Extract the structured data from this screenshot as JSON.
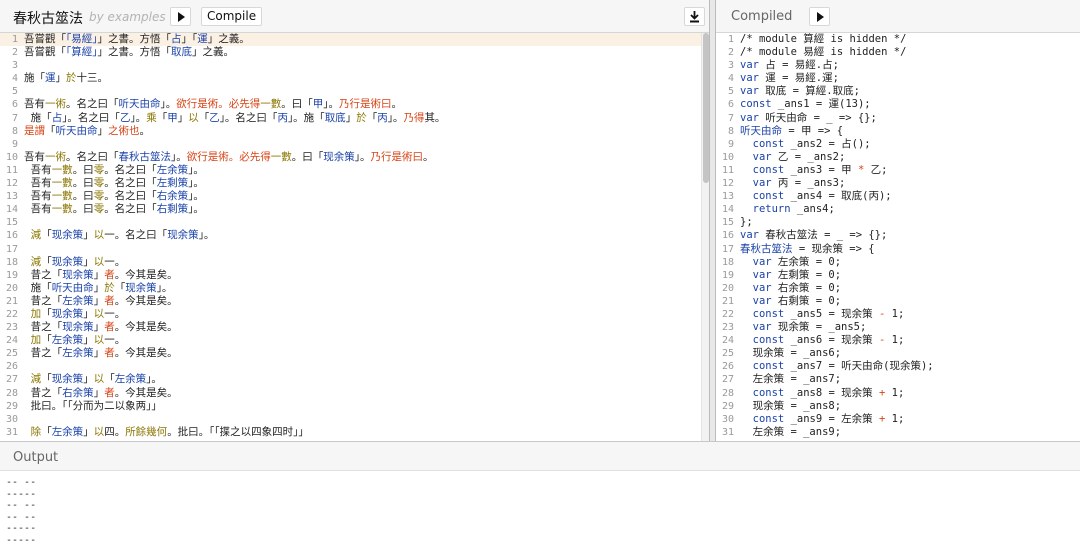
{
  "app": {
    "title": "春秋古筮法",
    "subtitle": "by examples",
    "compile_label": "Compile"
  },
  "right": {
    "title": "Compiled"
  },
  "output": {
    "title": "Output",
    "lines": [
      "-- --",
      "-----",
      "-- --",
      "-- --",
      "-----",
      "-----"
    ]
  },
  "source_lines": [
    [
      [
        "吾嘗觀「",
        "c-dark"
      ],
      [
        "「易經」",
        "c-blue"
      ],
      [
        "」之書。方悟「",
        "c-dark"
      ],
      [
        "占",
        "c-blue"
      ],
      [
        "」「",
        "c-dark"
      ],
      [
        "運",
        "c-blue"
      ],
      [
        "」之義。",
        "c-dark"
      ]
    ],
    [
      [
        "吾嘗觀「",
        "c-dark"
      ],
      [
        "「算經」",
        "c-blue"
      ],
      [
        "」之書。方悟「",
        "c-dark"
      ],
      [
        "取底",
        "c-blue"
      ],
      [
        "」之義。",
        "c-dark"
      ]
    ],
    [],
    [
      [
        "施「",
        "c-dark"
      ],
      [
        "運",
        "c-blue"
      ],
      [
        "」",
        "c-dark"
      ],
      [
        "於",
        "c-olive"
      ],
      [
        "十三。",
        "c-dark"
      ]
    ],
    [],
    [
      [
        "吾有",
        "c-dark"
      ],
      [
        "一術",
        "c-olive"
      ],
      [
        "。名之曰「",
        "c-dark"
      ],
      [
        "听天由命",
        "c-blue"
      ],
      [
        "」。",
        "c-dark"
      ],
      [
        "欲行是術。必先得",
        "c-orange"
      ],
      [
        "一數",
        "c-olive"
      ],
      [
        "。曰「",
        "c-dark"
      ],
      [
        "甲",
        "c-blue"
      ],
      [
        "」。",
        "c-dark"
      ],
      [
        "乃行是術曰",
        "c-orange"
      ],
      [
        "。",
        "c-dark"
      ]
    ],
    [
      [
        "  施「",
        "c-dark"
      ],
      [
        "占",
        "c-blue"
      ],
      [
        "」。名之曰「",
        "c-dark"
      ],
      [
        "乙",
        "c-blue"
      ],
      [
        "」。",
        "c-dark"
      ],
      [
        "乘",
        "c-olive"
      ],
      [
        "「",
        "c-dark"
      ],
      [
        "甲",
        "c-blue"
      ],
      [
        "」",
        "c-dark"
      ],
      [
        "以",
        "c-olive"
      ],
      [
        "「",
        "c-dark"
      ],
      [
        "乙",
        "c-blue"
      ],
      [
        "」。名之曰「",
        "c-dark"
      ],
      [
        "丙",
        "c-blue"
      ],
      [
        "」。施「",
        "c-dark"
      ],
      [
        "取底",
        "c-blue"
      ],
      [
        "」",
        "c-dark"
      ],
      [
        "於",
        "c-olive"
      ],
      [
        "「",
        "c-dark"
      ],
      [
        "丙",
        "c-blue"
      ],
      [
        "」。",
        "c-dark"
      ],
      [
        "乃得",
        "c-orange"
      ],
      [
        "其。",
        "c-dark"
      ]
    ],
    [
      [
        "是謂",
        "c-orange"
      ],
      [
        "「",
        "c-dark"
      ],
      [
        "听天由命",
        "c-blue"
      ],
      [
        "」",
        "c-dark"
      ],
      [
        "之術也",
        "c-orange"
      ],
      [
        "。",
        "c-dark"
      ]
    ],
    [],
    [
      [
        "吾有",
        "c-dark"
      ],
      [
        "一術",
        "c-olive"
      ],
      [
        "。名之曰「",
        "c-dark"
      ],
      [
        "春秋古筮法",
        "c-blue"
      ],
      [
        "」。",
        "c-dark"
      ],
      [
        "欲行是術。必先得",
        "c-orange"
      ],
      [
        "一數",
        "c-olive"
      ],
      [
        "。曰「",
        "c-dark"
      ],
      [
        "现余策",
        "c-blue"
      ],
      [
        "」。",
        "c-dark"
      ],
      [
        "乃行是術曰",
        "c-orange"
      ],
      [
        "。",
        "c-dark"
      ]
    ],
    [
      [
        "  吾有",
        "c-dark"
      ],
      [
        "一數",
        "c-olive"
      ],
      [
        "。曰",
        "c-dark"
      ],
      [
        "零",
        "c-olive"
      ],
      [
        "。名之曰「",
        "c-dark"
      ],
      [
        "左余策",
        "c-blue"
      ],
      [
        "」。",
        "c-dark"
      ]
    ],
    [
      [
        "  吾有",
        "c-dark"
      ],
      [
        "一數",
        "c-olive"
      ],
      [
        "。曰",
        "c-dark"
      ],
      [
        "零",
        "c-olive"
      ],
      [
        "。名之曰「",
        "c-dark"
      ],
      [
        "左剩策",
        "c-blue"
      ],
      [
        "」。",
        "c-dark"
      ]
    ],
    [
      [
        "  吾有",
        "c-dark"
      ],
      [
        "一數",
        "c-olive"
      ],
      [
        "。曰",
        "c-dark"
      ],
      [
        "零",
        "c-olive"
      ],
      [
        "。名之曰「",
        "c-dark"
      ],
      [
        "右余策",
        "c-blue"
      ],
      [
        "」。",
        "c-dark"
      ]
    ],
    [
      [
        "  吾有",
        "c-dark"
      ],
      [
        "一數",
        "c-olive"
      ],
      [
        "。曰",
        "c-dark"
      ],
      [
        "零",
        "c-olive"
      ],
      [
        "。名之曰「",
        "c-dark"
      ],
      [
        "右剩策",
        "c-blue"
      ],
      [
        "」。",
        "c-dark"
      ]
    ],
    [],
    [
      [
        "  減",
        "c-olive"
      ],
      [
        "「",
        "c-dark"
      ],
      [
        "现余策",
        "c-blue"
      ],
      [
        "」",
        "c-dark"
      ],
      [
        "以",
        "c-olive"
      ],
      [
        "一",
        "c-dark"
      ],
      [
        "。名之曰「",
        "c-dark"
      ],
      [
        "现余策",
        "c-blue"
      ],
      [
        "」。",
        "c-dark"
      ]
    ],
    [],
    [
      [
        "  減",
        "c-olive"
      ],
      [
        "「",
        "c-dark"
      ],
      [
        "现余策",
        "c-blue"
      ],
      [
        "」",
        "c-dark"
      ],
      [
        "以",
        "c-olive"
      ],
      [
        "一",
        "c-dark"
      ],
      [
        "。",
        "c-dark"
      ]
    ],
    [
      [
        "  昔之「",
        "c-dark"
      ],
      [
        "现余策",
        "c-blue"
      ],
      [
        "」",
        "c-dark"
      ],
      [
        "者",
        "c-orange"
      ],
      [
        "。今其是矣。",
        "c-dark"
      ]
    ],
    [
      [
        "  施「",
        "c-dark"
      ],
      [
        "听天由命",
        "c-blue"
      ],
      [
        "」",
        "c-dark"
      ],
      [
        "於",
        "c-olive"
      ],
      [
        "「",
        "c-dark"
      ],
      [
        "现余策",
        "c-blue"
      ],
      [
        "」。",
        "c-dark"
      ]
    ],
    [
      [
        "  昔之「",
        "c-dark"
      ],
      [
        "左余策",
        "c-blue"
      ],
      [
        "」",
        "c-dark"
      ],
      [
        "者",
        "c-orange"
      ],
      [
        "。今其是矣。",
        "c-dark"
      ]
    ],
    [
      [
        "  加",
        "c-olive"
      ],
      [
        "「",
        "c-dark"
      ],
      [
        "现余策",
        "c-blue"
      ],
      [
        "」",
        "c-dark"
      ],
      [
        "以",
        "c-olive"
      ],
      [
        "一",
        "c-dark"
      ],
      [
        "。",
        "c-dark"
      ]
    ],
    [
      [
        "  昔之「",
        "c-dark"
      ],
      [
        "现余策",
        "c-blue"
      ],
      [
        "」",
        "c-dark"
      ],
      [
        "者",
        "c-orange"
      ],
      [
        "。今其是矣。",
        "c-dark"
      ]
    ],
    [
      [
        "  加",
        "c-olive"
      ],
      [
        "「",
        "c-dark"
      ],
      [
        "左余策",
        "c-blue"
      ],
      [
        "」",
        "c-dark"
      ],
      [
        "以",
        "c-olive"
      ],
      [
        "一",
        "c-dark"
      ],
      [
        "。",
        "c-dark"
      ]
    ],
    [
      [
        "  昔之「",
        "c-dark"
      ],
      [
        "左余策",
        "c-blue"
      ],
      [
        "」",
        "c-dark"
      ],
      [
        "者",
        "c-orange"
      ],
      [
        "。今其是矣。",
        "c-dark"
      ]
    ],
    [],
    [
      [
        "  減",
        "c-olive"
      ],
      [
        "「",
        "c-dark"
      ],
      [
        "现余策",
        "c-blue"
      ],
      [
        "」",
        "c-dark"
      ],
      [
        "以",
        "c-olive"
      ],
      [
        "「",
        "c-dark"
      ],
      [
        "左余策",
        "c-blue"
      ],
      [
        "」。",
        "c-dark"
      ]
    ],
    [
      [
        "  昔之「",
        "c-dark"
      ],
      [
        "右余策",
        "c-blue"
      ],
      [
        "」",
        "c-dark"
      ],
      [
        "者",
        "c-orange"
      ],
      [
        "。今其是矣。",
        "c-dark"
      ]
    ],
    [
      [
        "  批曰。「「分而为二以象两」」",
        "c-dark"
      ]
    ],
    [],
    [
      [
        "  除",
        "c-olive"
      ],
      [
        "「",
        "c-dark"
      ],
      [
        "左余策",
        "c-blue"
      ],
      [
        "」",
        "c-dark"
      ],
      [
        "以",
        "c-olive"
      ],
      [
        "四",
        "c-dark"
      ],
      [
        "。",
        "c-dark"
      ],
      [
        "所餘幾何",
        "c-olive"
      ],
      [
        "。批曰。「「揲之以四象四时」」",
        "c-dark"
      ]
    ]
  ],
  "compiled_lines": [
    [
      [
        "/* module 算經 is hidden */",
        "c-dark"
      ]
    ],
    [
      [
        "/* module 易經 is hidden */",
        "c-dark"
      ]
    ],
    [
      [
        "var",
        "c-blue"
      ],
      [
        " 占 = 易經.占;",
        "c-dark"
      ]
    ],
    [
      [
        "var",
        "c-blue"
      ],
      [
        " 運 = 易經.運;",
        "c-dark"
      ]
    ],
    [
      [
        "var",
        "c-blue"
      ],
      [
        " 取底 = 算經.取底;",
        "c-dark"
      ]
    ],
    [
      [
        "const",
        "c-blue"
      ],
      [
        " _ans1 = 運(13);",
        "c-dark"
      ]
    ],
    [
      [
        "var",
        "c-blue"
      ],
      [
        " 听天由命 = _ => {};",
        "c-dark"
      ]
    ],
    [
      [
        "听天由命",
        "c-blue"
      ],
      [
        " = 甲 => {",
        "c-dark"
      ]
    ],
    [
      [
        "  const",
        "c-blue"
      ],
      [
        " _ans2 = 占();",
        "c-dark"
      ]
    ],
    [
      [
        "  var",
        "c-blue"
      ],
      [
        " 乙 = _ans2;",
        "c-dark"
      ]
    ],
    [
      [
        "  const",
        "c-blue"
      ],
      [
        " _ans3 = 甲 ",
        "c-dark"
      ],
      [
        "*",
        "c-orange"
      ],
      [
        " 乙;",
        "c-dark"
      ]
    ],
    [
      [
        "  var",
        "c-blue"
      ],
      [
        " 丙 = _ans3;",
        "c-dark"
      ]
    ],
    [
      [
        "  const",
        "c-blue"
      ],
      [
        " _ans4 = 取底(丙);",
        "c-dark"
      ]
    ],
    [
      [
        "  return",
        "c-blue"
      ],
      [
        " _ans4;",
        "c-dark"
      ]
    ],
    [
      [
        "};",
        "c-dark"
      ]
    ],
    [
      [
        "var",
        "c-blue"
      ],
      [
        " 春秋古筮法 = _ => {};",
        "c-dark"
      ]
    ],
    [
      [
        "春秋古筮法",
        "c-blue"
      ],
      [
        " = 现余策 => {",
        "c-dark"
      ]
    ],
    [
      [
        "  var",
        "c-blue"
      ],
      [
        " 左余策 = 0;",
        "c-dark"
      ]
    ],
    [
      [
        "  var",
        "c-blue"
      ],
      [
        " 左剩策 = 0;",
        "c-dark"
      ]
    ],
    [
      [
        "  var",
        "c-blue"
      ],
      [
        " 右余策 = 0;",
        "c-dark"
      ]
    ],
    [
      [
        "  var",
        "c-blue"
      ],
      [
        " 右剩策 = 0;",
        "c-dark"
      ]
    ],
    [
      [
        "  const",
        "c-blue"
      ],
      [
        " _ans5 = 现余策 ",
        "c-dark"
      ],
      [
        "-",
        "c-orange"
      ],
      [
        " 1;",
        "c-dark"
      ]
    ],
    [
      [
        "  var",
        "c-blue"
      ],
      [
        " 现余策 = _ans5;",
        "c-dark"
      ]
    ],
    [
      [
        "  const",
        "c-blue"
      ],
      [
        " _ans6 = 现余策 ",
        "c-dark"
      ],
      [
        "-",
        "c-orange"
      ],
      [
        " 1;",
        "c-dark"
      ]
    ],
    [
      [
        "  现余策 = _ans6;",
        "c-dark"
      ]
    ],
    [
      [
        "  const",
        "c-blue"
      ],
      [
        " _ans7 = 听天由命(现余策);",
        "c-dark"
      ]
    ],
    [
      [
        "  左余策 = _ans7;",
        "c-dark"
      ]
    ],
    [
      [
        "  const",
        "c-blue"
      ],
      [
        " _ans8 = 现余策 ",
        "c-dark"
      ],
      [
        "+",
        "c-orange"
      ],
      [
        " 1;",
        "c-dark"
      ]
    ],
    [
      [
        "  现余策 = _ans8;",
        "c-dark"
      ]
    ],
    [
      [
        "  const",
        "c-blue"
      ],
      [
        " _ans9 = 左余策 ",
        "c-dark"
      ],
      [
        "+",
        "c-orange"
      ],
      [
        " 1;",
        "c-dark"
      ]
    ],
    [
      [
        "  左余策 = _ans9;",
        "c-dark"
      ]
    ]
  ]
}
